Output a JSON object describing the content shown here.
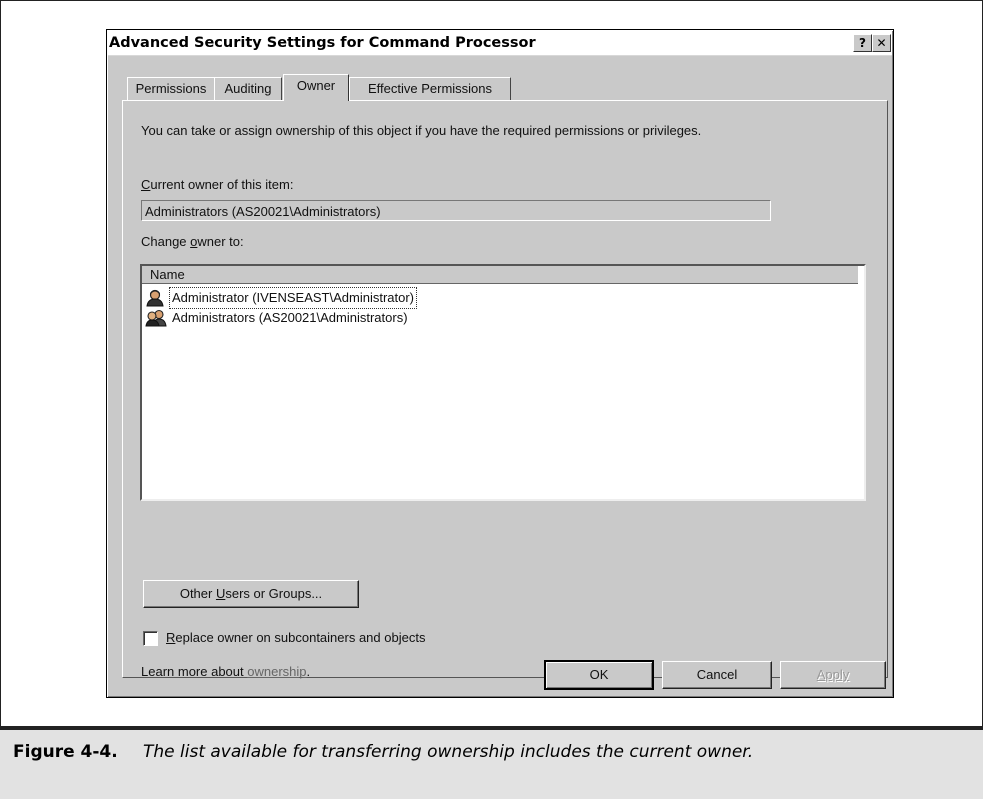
{
  "window": {
    "title": "Advanced Security Settings for Command Processor",
    "help_button": "?",
    "close_button": "✕"
  },
  "tabs": [
    {
      "label": "Permissions",
      "active": false
    },
    {
      "label": "Auditing",
      "active": false
    },
    {
      "label": "Owner",
      "active": true
    },
    {
      "label": "Effective Permissions",
      "active": false
    }
  ],
  "owner_tab": {
    "description": "You can take or assign ownership of this object if you have the required permissions or privileges.",
    "current_owner_label_key": "C",
    "current_owner_label_rest": "urrent owner of this item:",
    "current_owner_value": "Administrators (AS20021\\Administrators)",
    "change_owner_label_pre": "Change ",
    "change_owner_label_key": "o",
    "change_owner_label_rest": "wner to:",
    "list_header": "Name",
    "list_items": [
      {
        "label": "Administrator (IVENSEAST\\Administrator)",
        "icon": "user-icon"
      },
      {
        "label": "Administrators (AS20021\\Administrators)",
        "icon": "group-icon"
      }
    ],
    "other_users_pre": "Other ",
    "other_users_key": "U",
    "other_users_rest": "sers or Groups...",
    "replace_key": "R",
    "replace_rest": "eplace owner on subcontainers and objects",
    "replace_checked": false,
    "learn_more_prefix": "Learn more about ",
    "learn_more_link": "ownership",
    "learn_more_suffix": "."
  },
  "buttons": {
    "ok": "OK",
    "cancel": "Cancel",
    "apply": "Apply"
  },
  "caption": {
    "label": "Figure 4-4.",
    "text": "The list available for transferring ownership includes the current owner."
  }
}
